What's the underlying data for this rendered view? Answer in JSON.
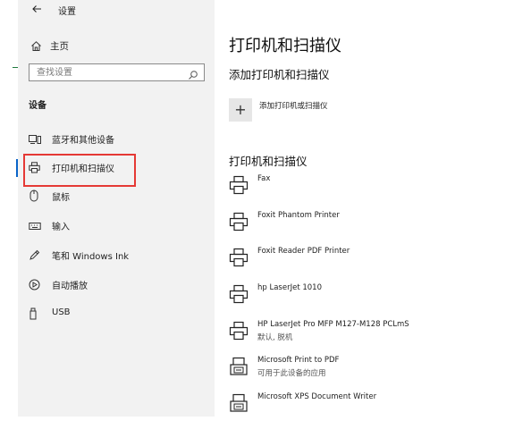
{
  "window": {
    "title": "设置",
    "back_icon": "back-arrow-icon"
  },
  "sidebar": {
    "home_label": "主页",
    "search_placeholder": "查找设置",
    "section_label": "设备",
    "items": [
      {
        "label": "蓝牙和其他设备",
        "icon": "bluetooth-devices-icon"
      },
      {
        "label": "打印机和扫描仪",
        "icon": "printer-icon",
        "selected": true
      },
      {
        "label": "鼠标",
        "icon": "mouse-icon"
      },
      {
        "label": "输入",
        "icon": "keyboard-icon"
      },
      {
        "label": "笔和 Windows Ink",
        "icon": "pen-icon"
      },
      {
        "label": "自动播放",
        "icon": "autoplay-icon"
      },
      {
        "label": "USB",
        "icon": "usb-icon"
      }
    ]
  },
  "main": {
    "page_title": "打印机和扫描仪",
    "add_section_title": "添加打印机和扫描仪",
    "add_button_label": "添加打印机或扫描仪",
    "list_section_title": "打印机和扫描仪",
    "printers": [
      {
        "name": "Fax",
        "status": ""
      },
      {
        "name": "Foxit Phantom Printer",
        "status": ""
      },
      {
        "name": "Foxit Reader PDF Printer",
        "status": ""
      },
      {
        "name": "hp LaserJet 1010",
        "status": ""
      },
      {
        "name": "HP LaserJet Pro MFP M127-M128 PCLmS",
        "status": "默认, 脱机"
      },
      {
        "name": "Microsoft Print to PDF",
        "status": "可用于此设备的应用"
      },
      {
        "name": "Microsoft XPS Document Writer",
        "status": ""
      }
    ]
  },
  "colors": {
    "sidebar_bg": "#f2f2f2",
    "selection_box": "#e53935",
    "accent": "#0a64c8"
  }
}
